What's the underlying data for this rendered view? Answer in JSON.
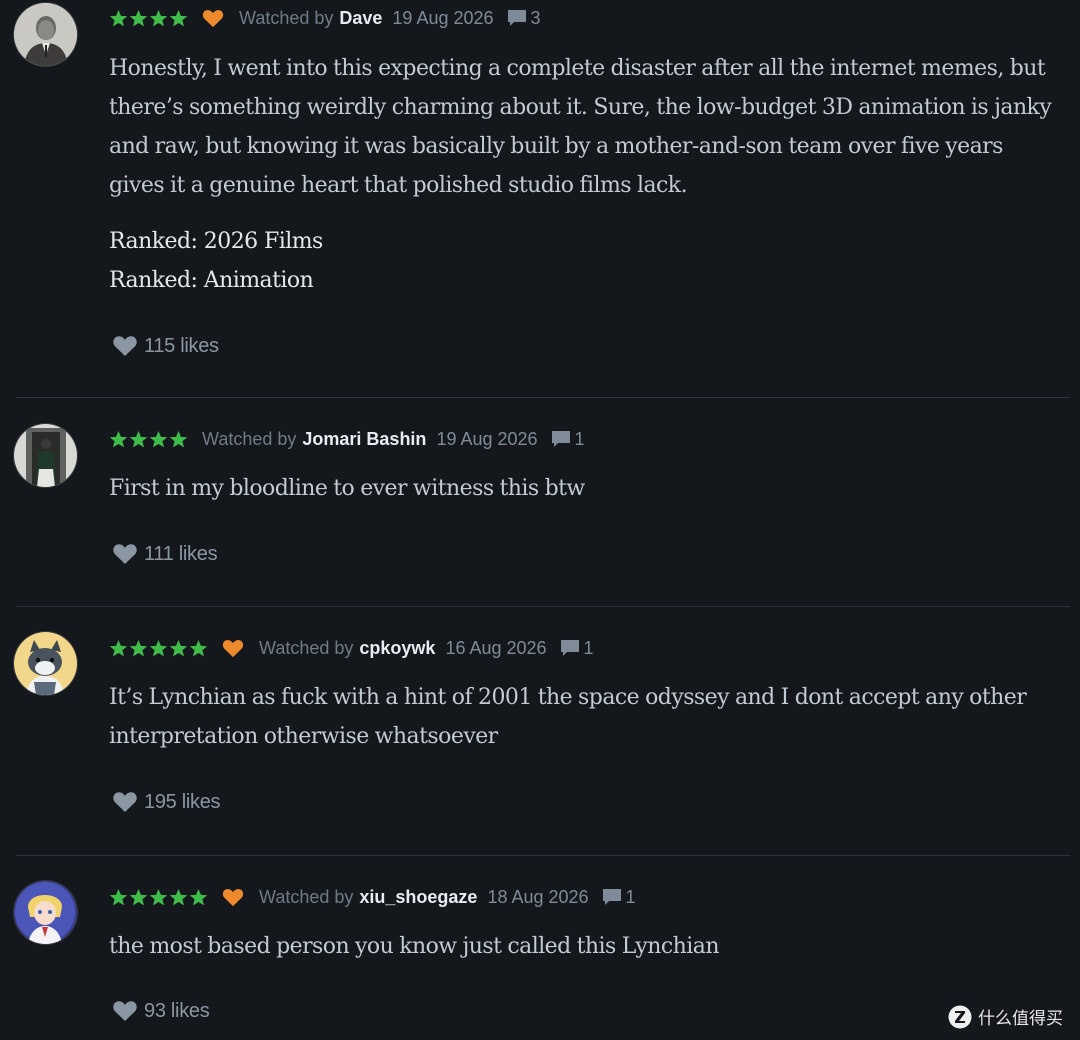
{
  "reviews": [
    {
      "avatar": "vintage-portrait-avatar",
      "rating_stars": 4,
      "liked": true,
      "watched_by_label": "Watched by",
      "username": "Dave",
      "date": "19 Aug 2026",
      "comment_count": "3",
      "body": "Honestly, I went into this expecting a complete disaster after all the internet memes, but there’s something weirdly charming about it. Sure, the low-budget 3D animation is janky and raw, but knowing it was basically built by a mother-and-son team over five years gives it a genuine heart that polished studio films lack.",
      "ranked": [
        "Ranked: 2026 Films",
        "Ranked: Animation"
      ],
      "likes": "115 likes"
    },
    {
      "avatar": "person-in-doorway-avatar",
      "rating_stars": 4,
      "liked": false,
      "watched_by_label": "Watched by",
      "username": "Jomari Bashin",
      "date": "19 Aug 2026",
      "comment_count": "1",
      "body": "First in my bloodline to ever witness this btw",
      "likes": "111 likes"
    },
    {
      "avatar": "cartoon-cat-avatar",
      "rating_stars": 5,
      "liked": true,
      "watched_by_label": "Watched by",
      "username": "cpkoywk",
      "date": "16 Aug 2026",
      "comment_count": "1",
      "body": "It’s Lynchian as fuck with a hint of 2001 the space odyssey and I dont accept any other interpretation otherwise whatsoever",
      "likes": "195 likes"
    },
    {
      "avatar": "anime-character-avatar",
      "rating_stars": 5,
      "liked": true,
      "watched_by_label": "Watched by",
      "username": "xiu_shoegaze",
      "date": "18 Aug 2026",
      "comment_count": "1",
      "body": "the most based person you know just called this Lynchian",
      "likes": "93 likes"
    }
  ],
  "watermark": {
    "icon": "zhi-logo-icon",
    "text": "什么值得买"
  },
  "colors": {
    "background": "#14181c",
    "star_green": "#40bc4a",
    "heart_orange": "#ee8a2e",
    "username": "#e6ecf1",
    "muted_text": "#7f8b99",
    "divider": "#2a323b"
  }
}
